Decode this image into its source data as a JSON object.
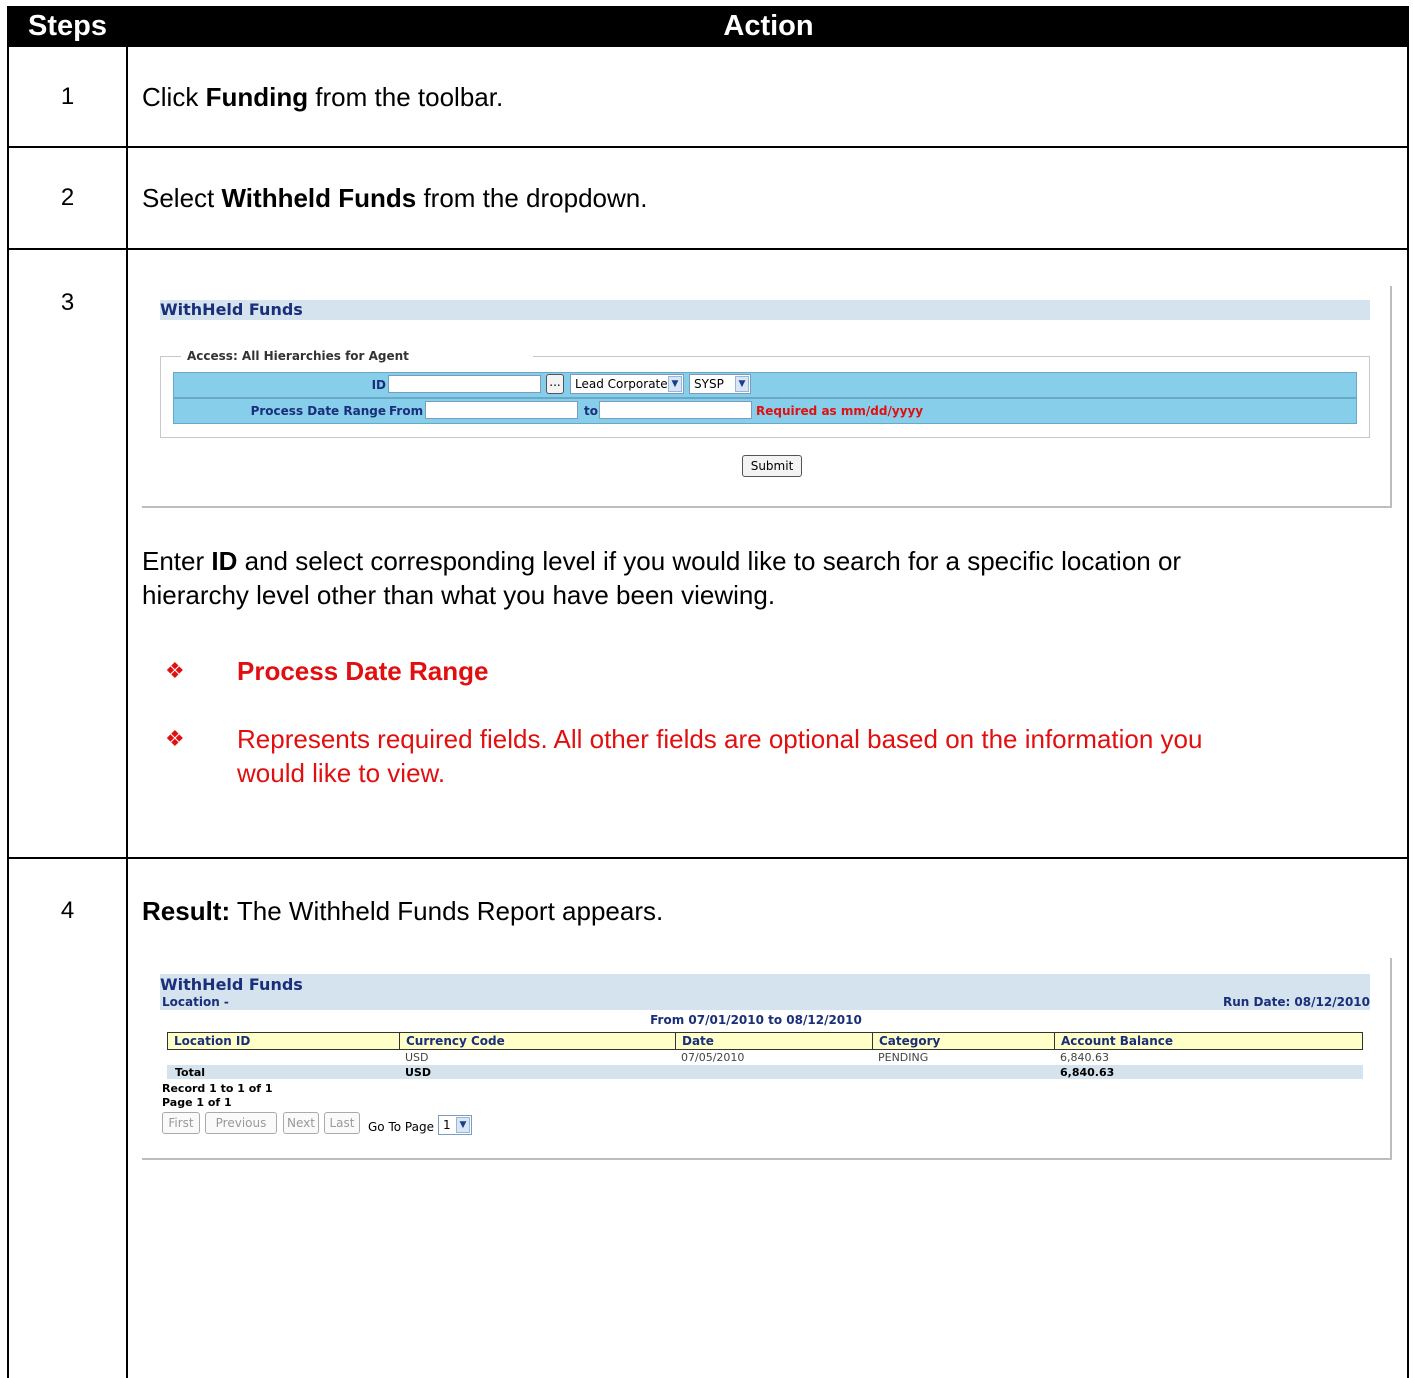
{
  "header": {
    "steps": "Steps",
    "action": "Action"
  },
  "steps": [
    {
      "number": "1",
      "pre": "Click ",
      "bold": "Funding",
      "post": " from the toolbar."
    },
    {
      "number": "2",
      "pre": "Select ",
      "bold": "Withheld Funds",
      "post": " from the dropdown."
    },
    {
      "number": "3"
    },
    {
      "number": "4"
    }
  ],
  "step3": {
    "pre": "Enter ",
    "bold": "ID",
    "post_line1": " and select corresponding level if you would like to search for a specific location or",
    "line2": "hierarchy level other than what you have been viewing.",
    "bullet1": "Process Date Range",
    "bullet2_line1": "Represents required fields. All other fields are optional based on the information you",
    "bullet2_line2": "would like to view.",
    "bullet_glyph": "❖"
  },
  "search_form": {
    "title": "WithHeld Funds",
    "legend": "Access: All Hierarchies for Agent",
    "id_label": "ID",
    "browse_button": "...",
    "level_select": "Lead Corporate",
    "system_select": "SYSP",
    "date_range_label": "Process Date Range",
    "from_label": "From",
    "to_label": "to",
    "required_note": "Required as mm/dd/yyyy",
    "submit_label": "Submit"
  },
  "step4": {
    "result_bold": "Result:",
    "result_text": " The Withheld Funds Report appears."
  },
  "report": {
    "title": "WithHeld Funds",
    "location_label": "Location -",
    "run_date": "Run Date: 08/12/2010",
    "date_range": "From 07/01/2010 to 08/12/2010",
    "columns": [
      "Location ID",
      "Currency Code",
      "Date",
      "Category",
      "Account Balance"
    ],
    "rows": [
      {
        "location_id": "",
        "currency": "USD",
        "date": "07/05/2010",
        "category": "PENDING",
        "balance": "6,840.63"
      }
    ],
    "total": {
      "label": "Total",
      "currency": "USD",
      "balance": "6,840.63"
    },
    "record_info": "Record 1 to 1 of 1",
    "page_info": "Page 1 of 1",
    "nav_buttons": {
      "first": "First",
      "previous": "Previous",
      "next": "Next",
      "last": "Last"
    },
    "go_to_page_label": "Go To Page",
    "page_select": "1"
  },
  "colors": {
    "required_red": "#e01010",
    "header_bg": "#000000",
    "title_bar": "#d4e3ee",
    "form_row": "#87ceeb",
    "report_header": "#ffffc8",
    "navy_text": "#1a2e7a"
  }
}
